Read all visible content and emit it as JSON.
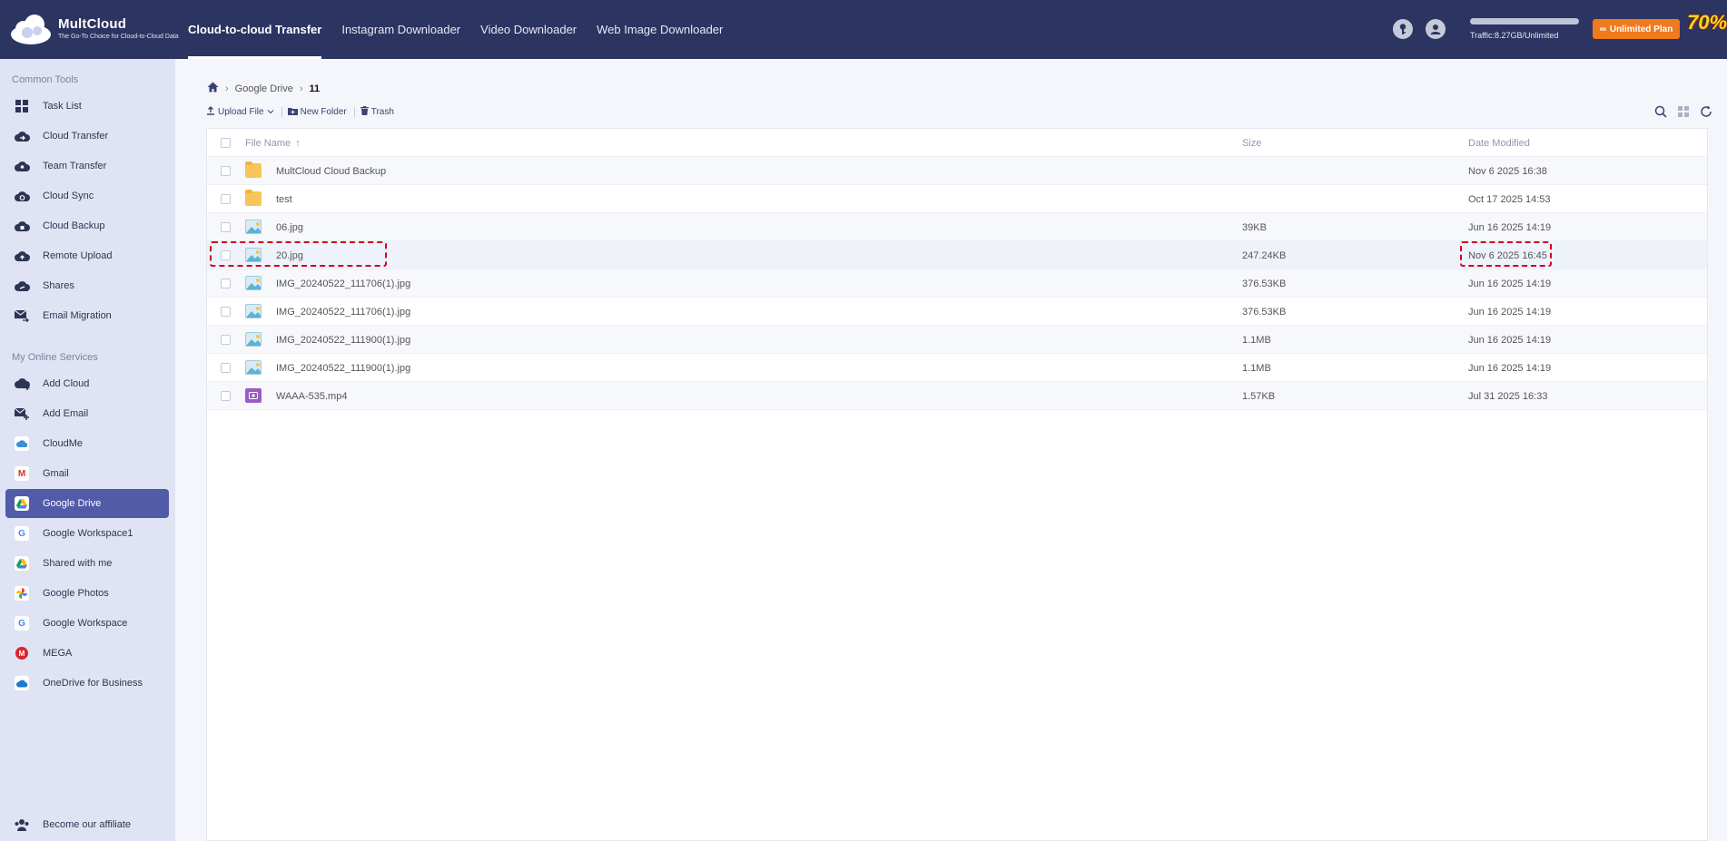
{
  "logo": {
    "name": "MultCloud",
    "tagline": "The Go-To Choice for Cloud-to-Cloud Data"
  },
  "topnav": [
    {
      "label": "Cloud-to-cloud Transfer",
      "active": true
    },
    {
      "label": "Instagram Downloader",
      "active": false
    },
    {
      "label": "Video Downloader",
      "active": false
    },
    {
      "label": "Web Image Downloader",
      "active": false
    }
  ],
  "header": {
    "traffic": "Traffic:8.27GB/Unlimited",
    "plan_button": "Unlimited Plan",
    "promo": "70%",
    "icons": [
      "key-icon",
      "user-icon"
    ]
  },
  "sidebar": {
    "common_title": "Common Tools",
    "common_items": [
      {
        "label": "Task List",
        "icon": "task-list-icon"
      },
      {
        "label": "Cloud Transfer",
        "icon": "cloud-transfer-icon"
      },
      {
        "label": "Team Transfer",
        "icon": "team-transfer-icon"
      },
      {
        "label": "Cloud Sync",
        "icon": "cloud-sync-icon"
      },
      {
        "label": "Cloud Backup",
        "icon": "cloud-backup-icon"
      },
      {
        "label": "Remote Upload",
        "icon": "remote-upload-icon"
      },
      {
        "label": "Shares",
        "icon": "shares-icon"
      },
      {
        "label": "Email Migration",
        "icon": "email-migration-icon"
      }
    ],
    "services_title": "My Online Services",
    "service_items": [
      {
        "label": "Add Cloud",
        "icon": "add-cloud-icon"
      },
      {
        "label": "Add Email",
        "icon": "add-email-icon"
      },
      {
        "label": "CloudMe",
        "icon": "cloudme-icon"
      },
      {
        "label": "Gmail",
        "icon": "gmail-icon"
      },
      {
        "label": "Google Drive",
        "icon": "google-drive-icon",
        "active": true
      },
      {
        "label": "Google Workspace1",
        "icon": "google-workspace-icon"
      },
      {
        "label": "Shared with me",
        "icon": "shared-with-me-icon"
      },
      {
        "label": "Google Photos",
        "icon": "google-photos-icon"
      },
      {
        "label": "Google Workspace",
        "icon": "google-workspace-icon"
      },
      {
        "label": "MEGA",
        "icon": "mega-icon"
      },
      {
        "label": "OneDrive for Business",
        "icon": "onedrive-icon"
      }
    ],
    "affiliate": "Become our affiliate"
  },
  "breadcrumb": {
    "root": "Google Drive",
    "current": "11"
  },
  "toolbar": {
    "upload": "Upload File",
    "new_folder": "New Folder",
    "trash": "Trash"
  },
  "table": {
    "headers": {
      "name": "File Name",
      "sort": "↑",
      "size": "Size",
      "date": "Date Modified"
    },
    "rows": [
      {
        "name": "MultCloud Cloud Backup",
        "size": "",
        "date": "Nov 6 2025 16:38",
        "type": "folder"
      },
      {
        "name": "test",
        "size": "",
        "date": "Oct 17 2025 14:53",
        "type": "folder"
      },
      {
        "name": "06.jpg",
        "size": "39KB",
        "date": "Jun 16 2025 14:19",
        "type": "image"
      },
      {
        "name": "20.jpg",
        "size": "247.24KB",
        "date": "Nov 6 2025 16:45",
        "type": "image",
        "selected": true
      },
      {
        "name": "IMG_20240522_111706(1).jpg",
        "size": "376.53KB",
        "date": "Jun 16 2025 14:19",
        "type": "image"
      },
      {
        "name": "IMG_20240522_111706(1).jpg",
        "size": "376.53KB",
        "date": "Jun 16 2025 14:19",
        "type": "image"
      },
      {
        "name": "IMG_20240522_111900(1).jpg",
        "size": "1.1MB",
        "date": "Jun 16 2025 14:19",
        "type": "image"
      },
      {
        "name": "IMG_20240522_111900(1).jpg",
        "size": "1.1MB",
        "date": "Jun 16 2025 14:19",
        "type": "image"
      },
      {
        "name": "WAAA-535.mp4",
        "size": "1.57KB",
        "date": "Jul 31 2025 16:33",
        "type": "video"
      }
    ]
  },
  "colors": {
    "header_bg": "#2c3461",
    "sidebar_bg": "#dfe3f3",
    "active_item": "#515ba7",
    "plan_button": "#f07a1c",
    "highlight": "#d0021b"
  }
}
